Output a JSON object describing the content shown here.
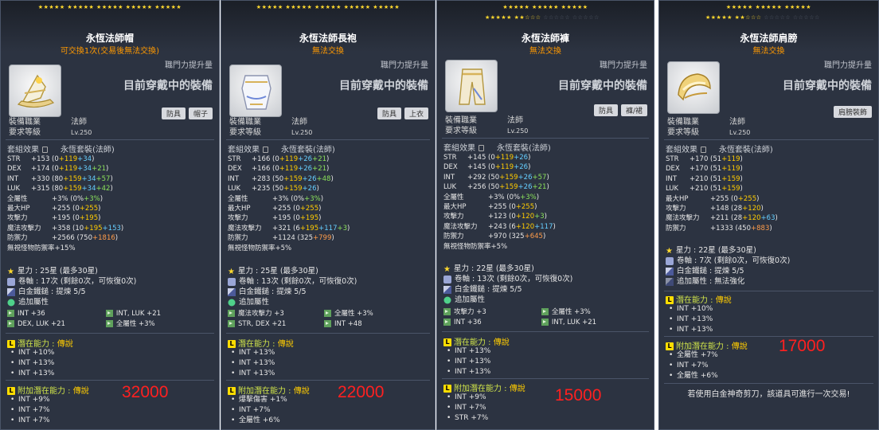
{
  "panels": [
    {
      "stars_row1": [
        "★★★★★",
        "★★★★★",
        "★★★★★",
        "★★★★★",
        "★★★★★"
      ],
      "stars_row2": [],
      "title": "永恆法師帽",
      "subtitle": "可交換1次(交易後無法交換)",
      "growth_label": "職門力提升量",
      "wearing": "目前穿戴中的裝備",
      "icon": "hat-icon",
      "tags": [
        "防具",
        "帽子"
      ],
      "req_job_label": "裝備職業",
      "req_job": "法師",
      "req_lvl_label": "要求等級",
      "req_lvl": "Lv.250",
      "set_label": "套組效果",
      "set_value": "永恆套裝(法師)",
      "stats": [
        {
          "n": "STR",
          "t": "+153 (0 ",
          "a": "+119",
          "b": " +34",
          "c": ")"
        },
        {
          "n": "DEX",
          "t": "+174 (0 ",
          "a": "+119",
          "b": " +34",
          "d": " +21",
          "c": ")"
        },
        {
          "n": "INT",
          "t": "+330 (80 ",
          "a": "+159",
          "b": " +34",
          "d": " +57",
          "c": ")"
        },
        {
          "n": "LUK",
          "t": "+315 (80 ",
          "a": "+159",
          "b": " +34",
          "d": " +42",
          "c": ")"
        },
        {
          "n": "全屬性",
          "t": "+3% (0% ",
          "d": "+3%",
          "c": ")"
        },
        {
          "n": "最大HP",
          "t": "+255 (0 ",
          "a": "+255",
          "c": ")"
        },
        {
          "n": "攻擊力",
          "t": "+195 (0 ",
          "a": "+195",
          "c": ")"
        },
        {
          "n": "魔法攻擊力",
          "t": "+358 (10 ",
          "a": "+195",
          "b": " +153",
          "c": ")"
        },
        {
          "n": "防禦力",
          "t": "+2566 (750 ",
          "e": "+1816",
          "c": ")"
        },
        {
          "n": "無視怪物防禦率",
          "t": " +15%"
        }
      ],
      "starforce": "星力 : 25星 (最多30星)",
      "scroll": "卷軸 : 17次 (剩餘0次，可恢復0次)",
      "hammer": "白金鐵鎚 : 提煉 5/5",
      "additional_label": "追加屬性",
      "additional": [
        [
          "INT +36",
          "INT, LUK +21"
        ],
        [
          "DEX, LUK +21",
          "全屬性 +3%"
        ]
      ],
      "potential_label": "潛在能力 :",
      "potential_grade": "傳說",
      "potential": [
        "INT +10%",
        "INT +13%",
        "INT +13%"
      ],
      "bonus_label": "附加潛在能力 :",
      "bonus_grade": "傳說",
      "bonus": [
        "INT +9%",
        "INT +7%",
        "INT +7%"
      ],
      "price": "32000",
      "footer": ""
    },
    {
      "stars_row1": [
        "★★★★★",
        "★★★★★",
        "★★★★★",
        "★★★★★",
        "★★★★★"
      ],
      "stars_row2": [],
      "title": "永恆法師長袍",
      "subtitle": "無法交換",
      "growth_label": "職門力提升量",
      "wearing": "目前穿戴中的裝備",
      "icon": "robe-icon",
      "tags": [
        "防具",
        "上衣"
      ],
      "req_job_label": "裝備職業",
      "req_job": "法師",
      "req_lvl_label": "要求等級",
      "req_lvl": "Lv.250",
      "set_label": "套組效果",
      "set_value": "永恆套裝(法師)",
      "stats": [
        {
          "n": "STR",
          "t": "+166 (0 ",
          "a": "+119",
          "b": " +26",
          "d": " +21",
          "c": ")"
        },
        {
          "n": "DEX",
          "t": "+166 (0 ",
          "a": "+119",
          "b": " +26",
          "d": " +21",
          "c": ")"
        },
        {
          "n": "INT",
          "t": "+283 (50 ",
          "a": "+159",
          "b": " +26",
          "d": " +48",
          "c": ")"
        },
        {
          "n": "LUK",
          "t": "+235 (50 ",
          "a": "+159",
          "b": " +26",
          "c": ")"
        },
        {
          "n": "全屬性",
          "t": "+3% (0% ",
          "d": "+3%",
          "c": ")"
        },
        {
          "n": "最大HP",
          "t": "+255 (0 ",
          "a": "+255",
          "c": ")"
        },
        {
          "n": "攻擊力",
          "t": "+195 (0 ",
          "a": "+195",
          "c": ")"
        },
        {
          "n": "魔法攻擊力",
          "t": "+321 (6 ",
          "a": "+195",
          "b": " +117",
          "d": " +3",
          "c": ")"
        },
        {
          "n": "防禦力",
          "t": "+1124 (325 ",
          "e": "+799",
          "c": ")"
        },
        {
          "n": "無視怪物防禦率",
          "t": " +5%"
        }
      ],
      "starforce": "星力 : 25星 (最多30星)",
      "scroll": "卷軸 : 13次 (剩餘0次，可恢復0次)",
      "hammer": "白金鐵鎚 : 提煉 5/5",
      "additional_label": "追加屬性",
      "additional": [
        [
          "魔法攻擊力 +3",
          "全屬性 +3%"
        ],
        [
          "STR, DEX +21",
          "INT +48"
        ]
      ],
      "potential_label": "潛在能力 :",
      "potential_grade": "傳說",
      "potential": [
        "INT +13%",
        "INT +13%",
        "INT +13%"
      ],
      "bonus_label": "附加潛在能力 :",
      "bonus_grade": "傳說",
      "bonus": [
        "爆擊傷害 +1%",
        "INT +7%",
        "全屬性 +6%"
      ],
      "price": "22000",
      "footer": ""
    },
    {
      "stars_row1": [
        "★★★★★",
        "★★★★★",
        "★★★★★"
      ],
      "stars_row2": [
        "★★★★★",
        "★★☆☆☆",
        "☆☆☆☆☆",
        "☆☆☆☆☆"
      ],
      "title": "永恆法師褲",
      "subtitle": "無法交換",
      "growth_label": "職門力提升量",
      "wearing": "目前穿戴中的裝備",
      "icon": "pants-icon",
      "tags": [
        "防具",
        "褲/裙"
      ],
      "req_job_label": "裝備職業",
      "req_job": "法師",
      "req_lvl_label": "要求等級",
      "req_lvl": "Lv.250",
      "set_label": "套組效果",
      "set_value": "永恆套裝(法師)",
      "stats": [
        {
          "n": "STR",
          "t": "+145 (0 ",
          "a": "+119",
          "b": " +26",
          "c": ")"
        },
        {
          "n": "DEX",
          "t": "+145 (0 ",
          "a": "+119",
          "b": " +26",
          "c": ")"
        },
        {
          "n": "INT",
          "t": "+292 (50 ",
          "a": "+159",
          "b": " +26",
          "d": " +57",
          "c": ")"
        },
        {
          "n": "LUK",
          "t": "+256 (50 ",
          "a": "+159",
          "b": " +26",
          "d": " +21",
          "c": ")"
        },
        {
          "n": "全屬性",
          "t": "+3% (0% ",
          "d": "+3%",
          "c": ")"
        },
        {
          "n": "最大HP",
          "t": "+255 (0 ",
          "a": "+255",
          "c": ")"
        },
        {
          "n": "攻擊力",
          "t": "+123 (0 ",
          "a": "+120",
          "d": " +3",
          "c": ")"
        },
        {
          "n": "魔法攻擊力",
          "t": "+243 (6 ",
          "a": "+120",
          "b": " +117",
          "c": ")"
        },
        {
          "n": "防禦力",
          "t": "+970 (325 ",
          "e": "+645",
          "c": ")"
        },
        {
          "n": "無視怪物防禦率",
          "t": " +5%"
        }
      ],
      "starforce": "星力 : 22星 (最多30星)",
      "scroll": "卷軸 : 13次 (剩餘0次，可恢復0次)",
      "hammer": "白金鐵鎚 : 提煉 5/5",
      "additional_label": "追加屬性",
      "additional": [
        [
          "攻擊力 +3",
          "全屬性 +3%"
        ],
        [
          "INT +36",
          "INT, LUK +21"
        ]
      ],
      "potential_label": "潛在能力 :",
      "potential_grade": "傳說",
      "potential": [
        "INT +13%",
        "INT +13%",
        "INT +13%"
      ],
      "bonus_label": "附加潛在能力 :",
      "bonus_grade": "傳說",
      "bonus": [
        "INT +9%",
        "INT +7%",
        "STR +7%"
      ],
      "price": "15000",
      "footer": ""
    },
    {
      "stars_row1": [
        "★★★★★",
        "★★★★★",
        "★★★★★"
      ],
      "stars_row2": [
        "★★★★★",
        "★★☆☆☆",
        "☆☆☆☆☆",
        "☆☆☆☆☆"
      ],
      "title": "永恆法師肩膀",
      "subtitle": "無法交換",
      "growth_label": "職門力提升量",
      "wearing": "目前穿戴中的裝備",
      "icon": "shoulder-icon",
      "tags": [
        "肩膀裝飾"
      ],
      "req_job_label": "裝備職業",
      "req_job": "法師",
      "req_lvl_label": "要求等級",
      "req_lvl": "Lv.250",
      "set_label": "套組效果",
      "set_value": "永恆套裝(法師)",
      "stats": [
        {
          "n": "STR",
          "t": "+170 (51 ",
          "a": "+119",
          "c": ")"
        },
        {
          "n": "DEX",
          "t": "+170 (51 ",
          "a": "+119",
          "c": ")"
        },
        {
          "n": "INT",
          "t": "+210 (51 ",
          "a": "+159",
          "c": ")"
        },
        {
          "n": "LUK",
          "t": "+210 (51 ",
          "a": "+159",
          "c": ")"
        },
        {
          "n": "最大HP",
          "t": "+255 (0 ",
          "a": "+255",
          "c": ")"
        },
        {
          "n": "攻擊力",
          "t": "+148 (28 ",
          "a": "+120",
          "c": ")"
        },
        {
          "n": "魔法攻擊力",
          "t": "+211 (28 ",
          "a": "+120",
          "b": " +63",
          "c": ")"
        },
        {
          "n": "防禦力",
          "t": "+1333 (450 ",
          "e": "+883",
          "c": ")"
        }
      ],
      "starforce": "星力 : 22星 (最多30星)",
      "scroll": "卷軸 : 7次 (剩餘0次，可恢復0次)",
      "hammer": "白金鐵鎚 : 提煉 5/5",
      "flame_label": "追加屬性",
      "flame_value": "無法強化",
      "potential_label": "潛在能力 :",
      "potential_grade": "傳說",
      "potential": [
        "INT +10%",
        "INT +13%",
        "INT +13%"
      ],
      "bonus_label": "附加潛在能力 :",
      "bonus_grade": "傳說",
      "bonus": [
        "全屬性 +7%",
        "INT +7%",
        "全屬性 +6%"
      ],
      "price": "17000",
      "footer": "若使用白金神奇剪刀，該道具可進行一次交易!"
    }
  ],
  "colors": {
    "panel_bg": "#2c3341",
    "star": "#ffd92e",
    "price": "#ff2020",
    "potential_label": "#cfe34a",
    "grade": "#ffcc00",
    "subtitle": "#ff9900"
  }
}
